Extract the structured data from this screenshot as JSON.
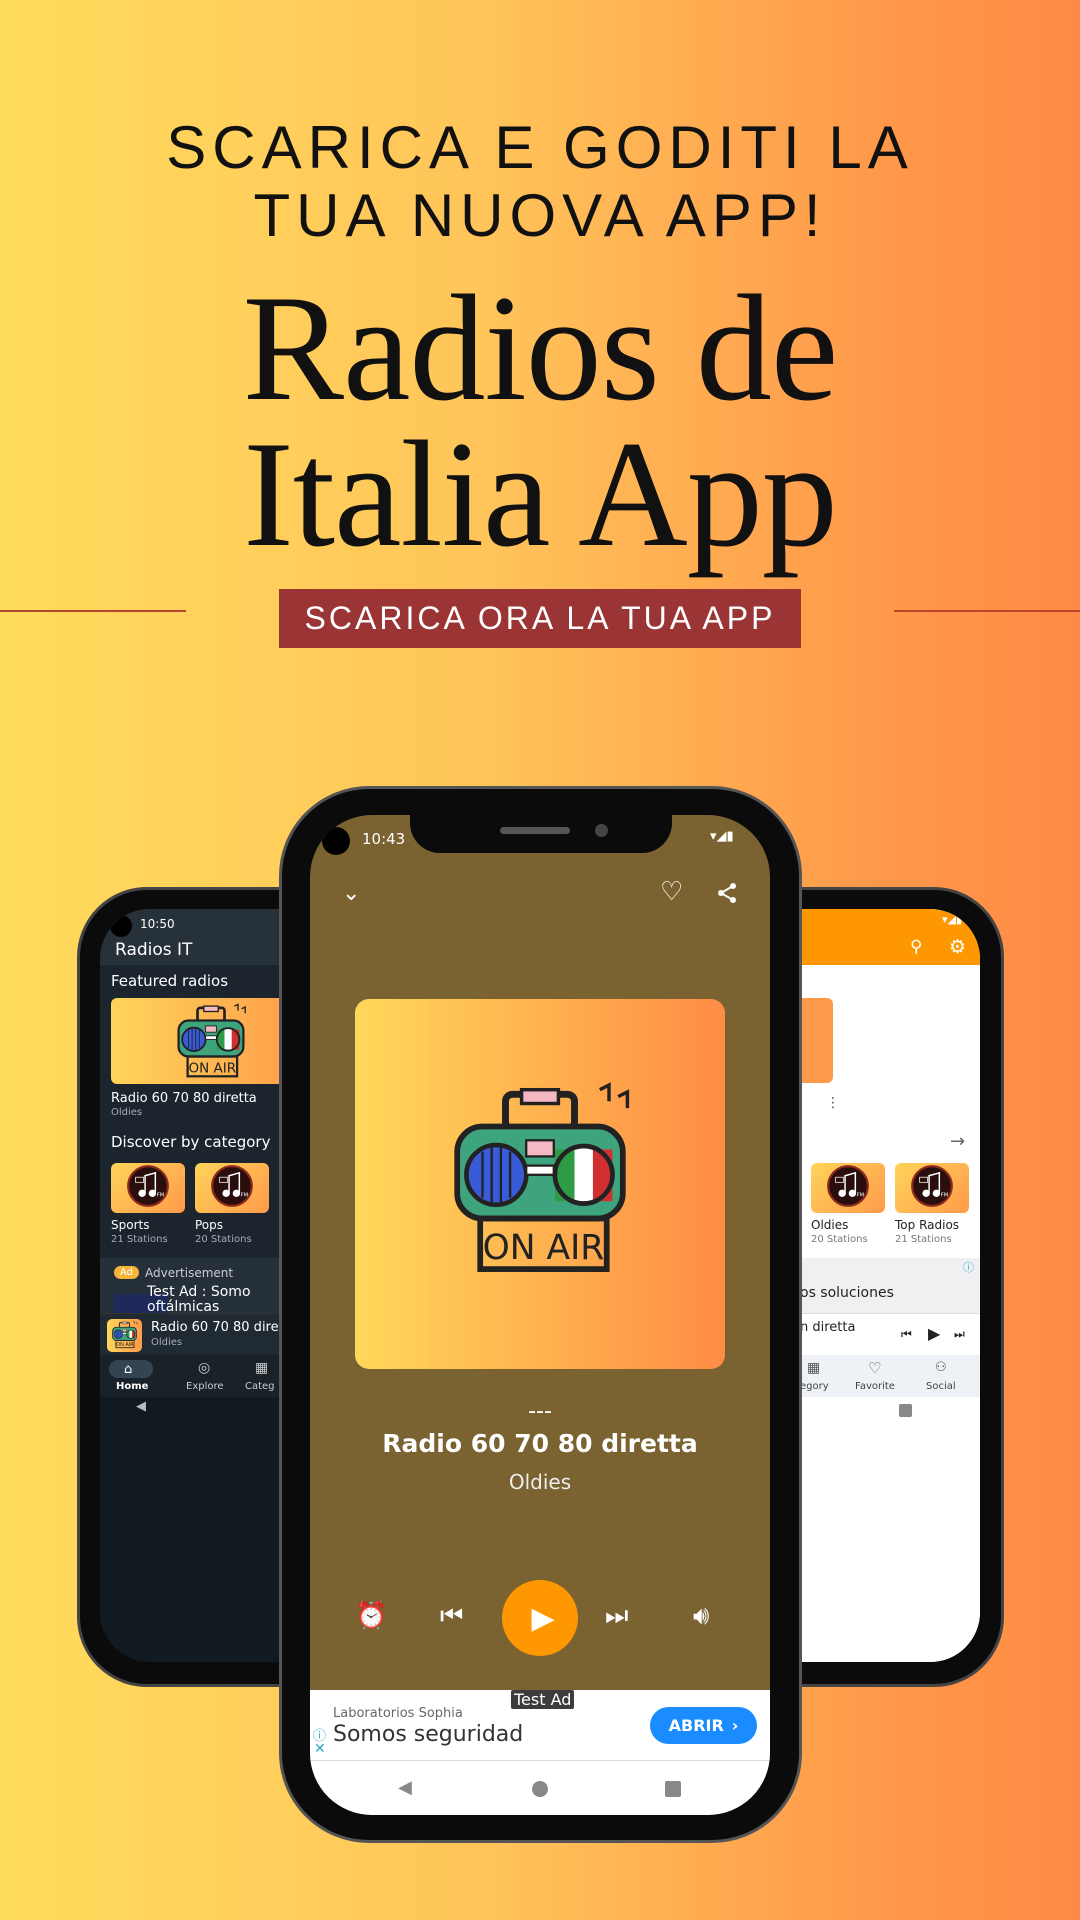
{
  "promo": {
    "headline_1": "SCARICA E GODITI LA",
    "headline_2": "TUA NUOVA APP!",
    "title_1": "Radios de",
    "title_2": "Italia App",
    "banner": "SCARICA ORA LA TUA APP"
  },
  "colors": {
    "accent": "#ff9800",
    "player_bg": "#7a6330",
    "banner": "#9b3535",
    "ad_button": "#1a8cff"
  },
  "left_phone": {
    "time": "10:50",
    "app_title": "Radios IT",
    "featured_title": "Featured radios",
    "featured": {
      "name": "Radio 60 70 80 diretta",
      "category": "Oldies"
    },
    "discover_title": "Discover by category",
    "categories": [
      {
        "name": "Sports",
        "count": "21 Stations"
      },
      {
        "name": "Pops",
        "count": "20 Stations"
      }
    ],
    "ad_badge": "Ad",
    "ad_label": "Advertisement",
    "ad_text_1": "Test Ad : Somo",
    "ad_text_2": "oftálmicas",
    "mini_player": {
      "name": "Radio 60 70 80 diret",
      "category": "Oldies"
    },
    "nav": [
      {
        "label": "Home",
        "icon": "home-icon"
      },
      {
        "label": "Explore",
        "icon": "compass-icon"
      },
      {
        "label": "Categ",
        "icon": "grid-icon"
      }
    ]
  },
  "center_phone": {
    "time": "10:43",
    "art_text": "ON AIR",
    "dashes": "---",
    "station": "Radio 60 70 80 diretta",
    "category": "Oldies",
    "ad": {
      "label": "Test Ad",
      "advertiser": "Laboratorios Sophia",
      "headline": "Somos seguridad",
      "button": "ABRIR"
    }
  },
  "right_phone": {
    "categories": [
      {
        "name": "Oldies",
        "count": "20 Stations"
      },
      {
        "name": "Top Radios",
        "count": "21 Stations"
      }
    ],
    "ad_text": "os soluciones",
    "mini_player_name": "n diretta",
    "nav": [
      {
        "label": "egory",
        "icon": "grid-icon"
      },
      {
        "label": "Favorite",
        "icon": "heart-icon"
      },
      {
        "label": "Social",
        "icon": "people-icon"
      }
    ]
  }
}
